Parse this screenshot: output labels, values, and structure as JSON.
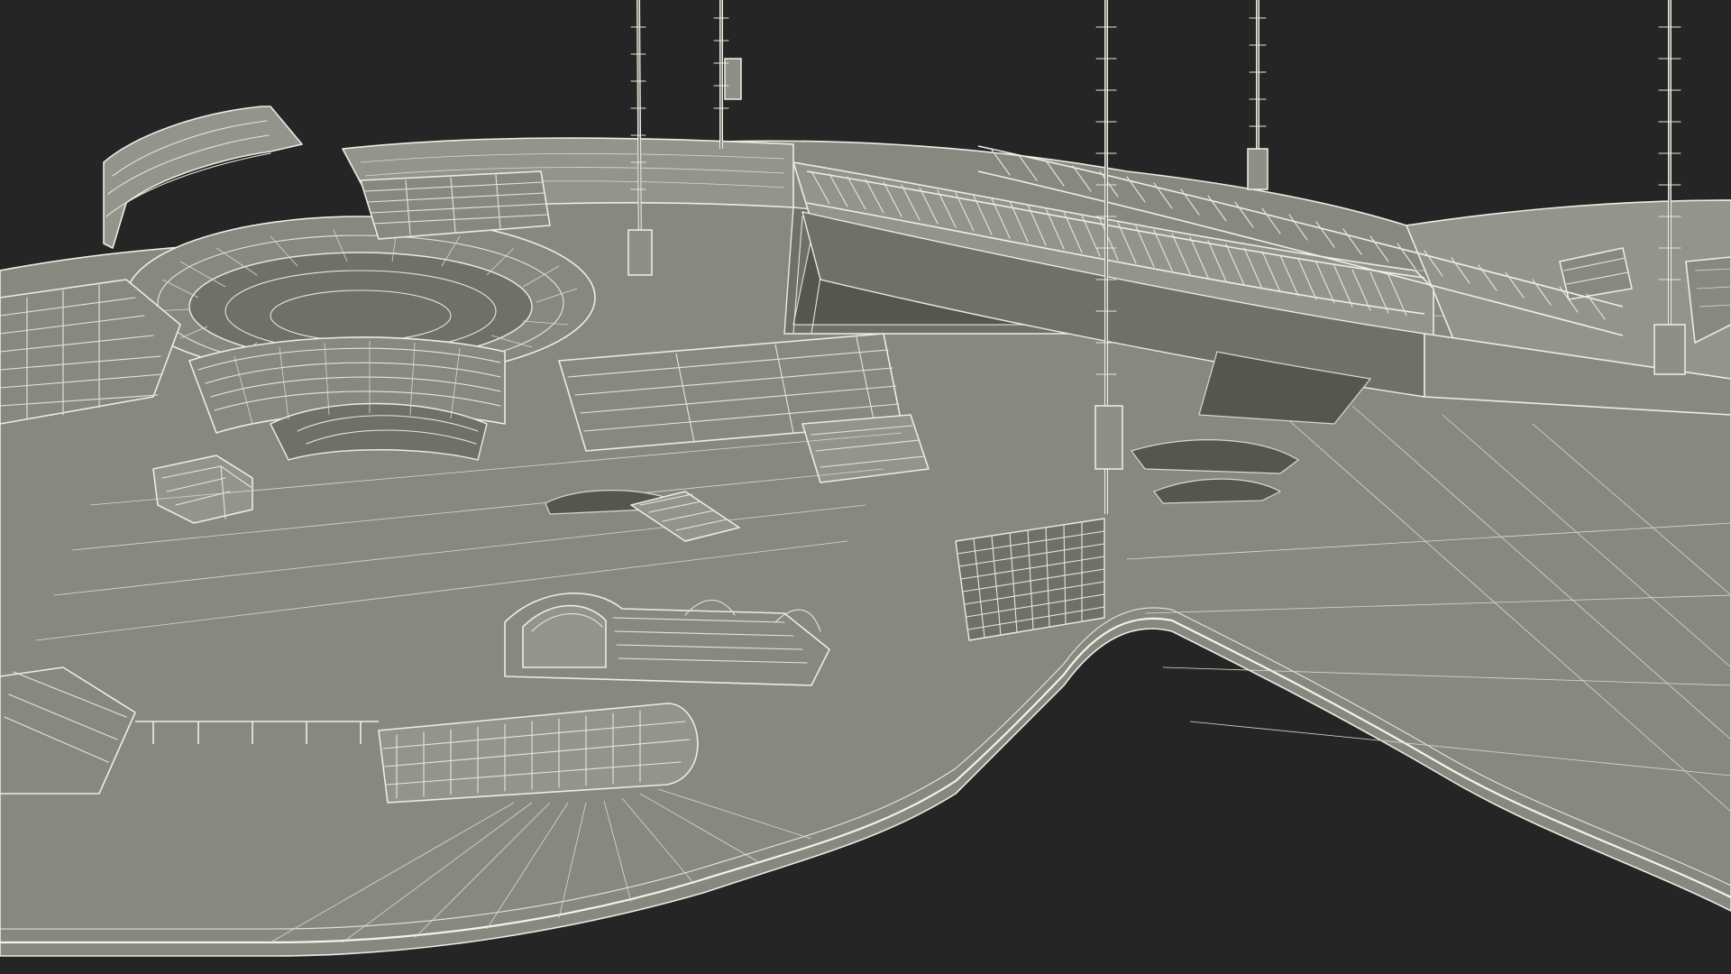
{
  "scene": {
    "background_color": "#252525",
    "surface_color": "#878880",
    "wire_color": "#ecece2",
    "shadow_color": "#55564f",
    "subject": "wireframe-skate-park-model"
  }
}
